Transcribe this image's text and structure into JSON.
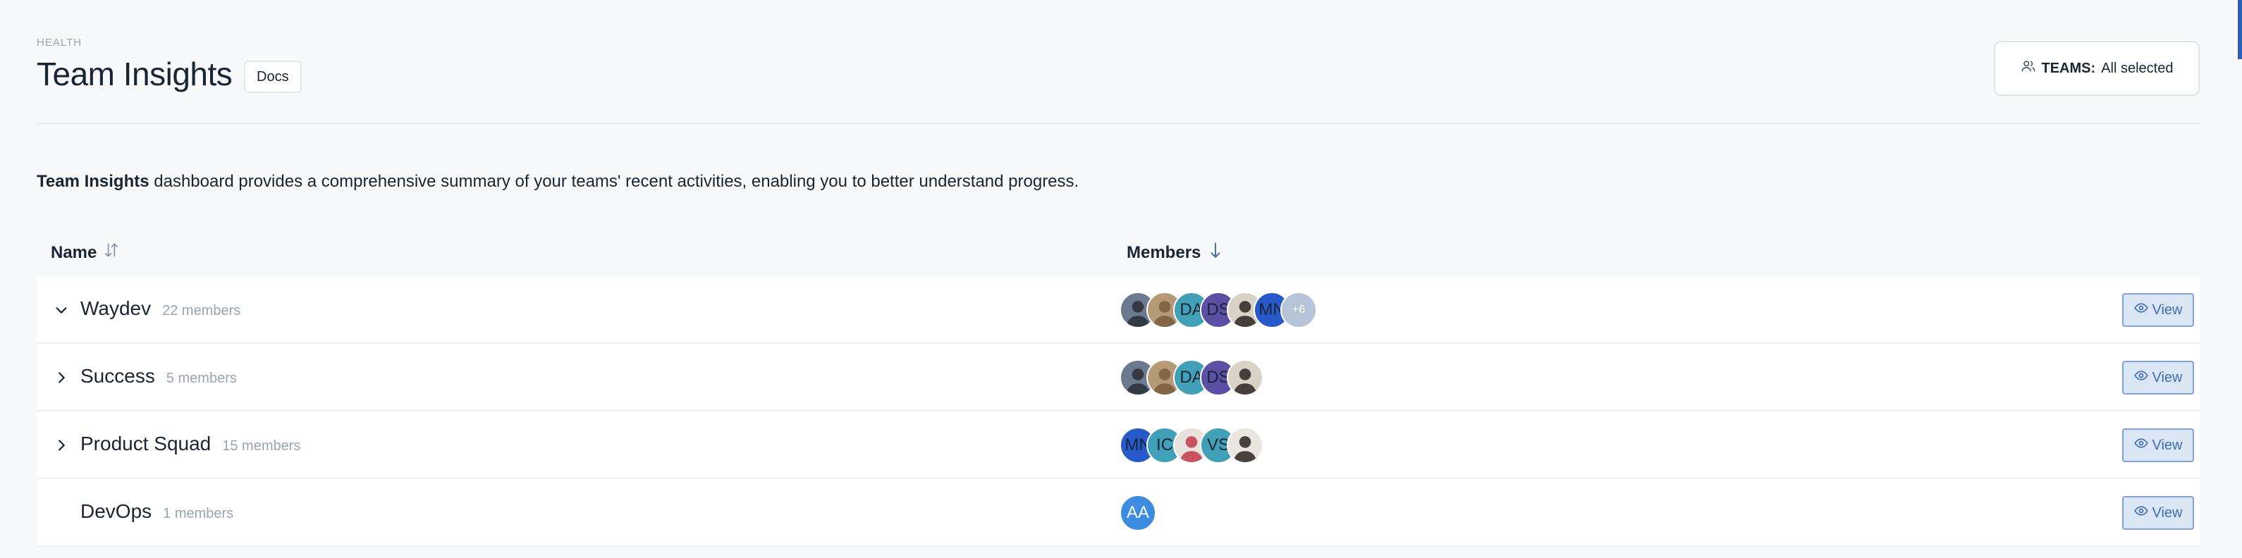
{
  "header": {
    "eyebrow": "HEALTH",
    "title": "Team Insights",
    "docs_label": "Docs",
    "teams_filter": {
      "label": "TEAMS:",
      "value": "All selected"
    }
  },
  "description": {
    "bold": "Team Insights",
    "text": " dashboard provides a comprehensive summary of your teams' recent activities, enabling you to better understand progress."
  },
  "table": {
    "columns": {
      "name": "Name",
      "members": "Members"
    },
    "view_label": "View",
    "rows": [
      {
        "name": "Waydev",
        "count": "22 members",
        "expanded": true,
        "more": "+6",
        "avatars": [
          {
            "type": "photo",
            "bg": "#6b7a8c",
            "fg": "#2a2f36"
          },
          {
            "type": "photo",
            "bg": "#b59a78",
            "fg": "#7a5d3f"
          },
          {
            "type": "initials",
            "text": "DA",
            "bg": "#3fa0b8"
          },
          {
            "type": "initials",
            "text": "DS",
            "bg": "#5b4fa6"
          },
          {
            "type": "photo",
            "bg": "#d9d2c7",
            "fg": "#2b2521"
          },
          {
            "type": "initials",
            "text": "MN",
            "bg": "#2659c9"
          }
        ]
      },
      {
        "name": "Success",
        "count": "5 members",
        "expanded": false,
        "avatars": [
          {
            "type": "photo",
            "bg": "#6b7a8c",
            "fg": "#2a2f36"
          },
          {
            "type": "photo",
            "bg": "#b59a78",
            "fg": "#7a5d3f"
          },
          {
            "type": "initials",
            "text": "DA",
            "bg": "#3fa0b8"
          },
          {
            "type": "initials",
            "text": "DS",
            "bg": "#5b4fa6"
          },
          {
            "type": "photo",
            "bg": "#d9d2c7",
            "fg": "#2b2521"
          }
        ]
      },
      {
        "name": "Product Squad",
        "count": "15 members",
        "expanded": false,
        "avatars": [
          {
            "type": "initials",
            "text": "MN",
            "bg": "#2659c9"
          },
          {
            "type": "initials",
            "text": "IC",
            "bg": "#3fa0b8"
          },
          {
            "type": "photo",
            "bg": "#e8e2dc",
            "fg": "#c2384a"
          },
          {
            "type": "initials",
            "text": "VS",
            "bg": "#3fa0b8"
          },
          {
            "type": "photo",
            "bg": "#e9e6e2",
            "fg": "#2b2521"
          }
        ]
      },
      {
        "name": "DevOps",
        "count": "1 members",
        "expanded": null,
        "avatars": [
          {
            "type": "initials",
            "text": "AA",
            "bg": "#3c8ce0",
            "white": true
          }
        ]
      }
    ]
  },
  "colors": {
    "accent": "#3c6cb4",
    "view_bg": "#dbe6f4",
    "muted_text": "#9aa3b2"
  }
}
